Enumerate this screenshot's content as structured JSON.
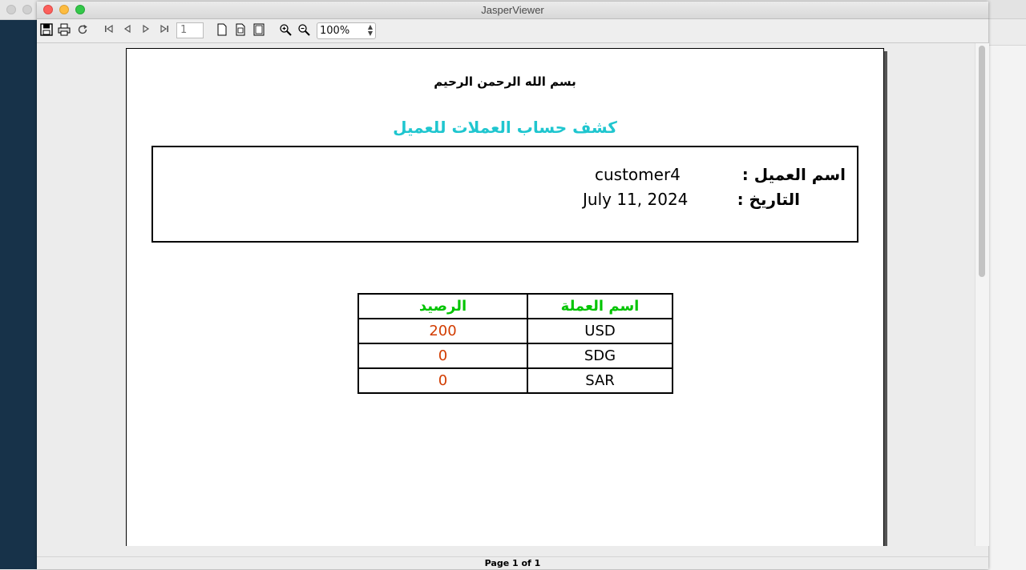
{
  "window": {
    "title": "JasperViewer"
  },
  "toolbar": {
    "page_number": "1",
    "zoom": "100%",
    "icons": [
      "save-icon",
      "print-icon",
      "reload-icon",
      "first-page-icon",
      "previous-page-icon",
      "next-page-icon",
      "last-page-icon",
      "actual-size-icon",
      "fit-page-icon",
      "fit-width-icon",
      "zoom-in-icon",
      "zoom-out-icon"
    ]
  },
  "report": {
    "bismillah": "بسم الله الرحمن الرحيم",
    "title": "كشف حساب العملات للعميل",
    "customer_label": "اسم العميل :",
    "customer_value": "customer4",
    "date_label": "التاريخ :",
    "date_value": "July 11, 2024",
    "table": {
      "headers": {
        "currency": "اسم العملة",
        "balance": "الرصيد"
      },
      "rows": [
        {
          "currency": "USD",
          "balance": "200"
        },
        {
          "currency": "SDG",
          "balance": "0"
        },
        {
          "currency": "SAR",
          "balance": "0"
        }
      ]
    }
  },
  "status": {
    "page_info": "Page 1 of 1"
  },
  "colors": {
    "title": "#1fc6cf",
    "header": "#00c400",
    "amount": "#d23c00"
  }
}
